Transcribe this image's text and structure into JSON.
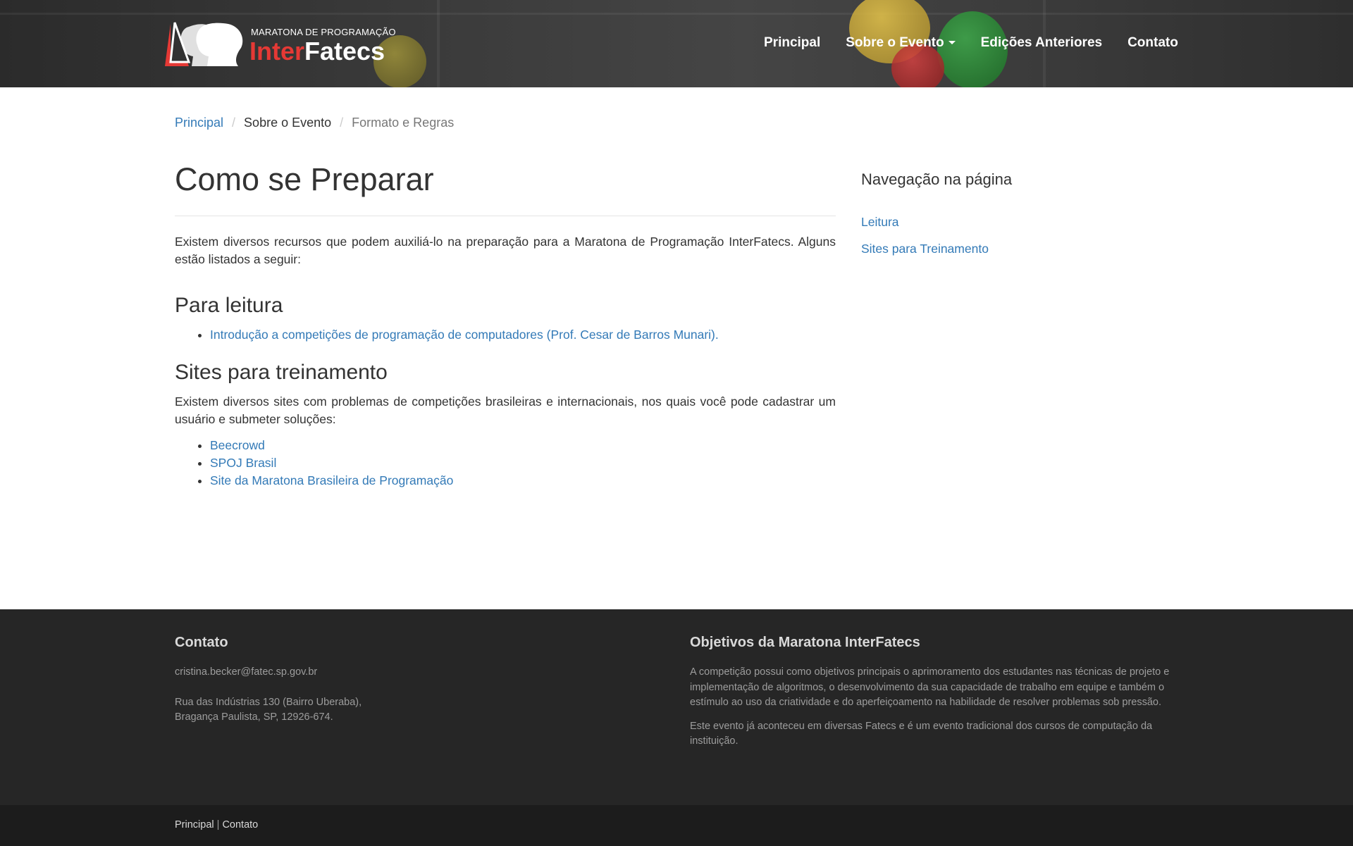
{
  "header": {
    "logo_subtitle": "MARATONA DE PROGRAMAÇÃO",
    "logo_inter": "Inter",
    "logo_fatecs": "Fatecs",
    "nav": {
      "principal": "Principal",
      "sobre": "Sobre o Evento",
      "edicoes": "Edições Anteriores",
      "contato": "Contato"
    }
  },
  "breadcrumb": {
    "item1": "Principal",
    "item2": "Sobre o Evento",
    "item3": "Formato e Regras",
    "separator": "/"
  },
  "main": {
    "title": "Como se Preparar",
    "intro": "Existem diversos recursos que podem auxiliá-lo na preparação para a Maratona de Programação InterFatecs. Alguns estão listados a seguir:",
    "reading_heading": "Para leitura",
    "reading_links": [
      "Introdução a competições de programação de computadores (Prof. Cesar de Barros Munari)."
    ],
    "training_heading": "Sites para treinamento",
    "training_text": "Existem diversos sites com problemas de competições brasileiras e internacionais, nos quais você pode cadastrar um usuário e submeter soluções:",
    "training_links": [
      "Beecrowd",
      "SPOJ Brasil",
      "Site da Maratona Brasileira de Programação"
    ]
  },
  "sidebar": {
    "title": "Navegação na página",
    "links": [
      "Leitura",
      "Sites para Treinamento"
    ]
  },
  "footer": {
    "contact_heading": "Contato",
    "email": "cristina.becker@fatec.sp.gov.br",
    "address_line1": "Rua das Indústrias 130 (Bairro Uberaba),",
    "address_line2": "Bragança Paulista, SP, 12926-674.",
    "objectives_heading": "Objetivos da Maratona InterFatecs",
    "objectives_p1": "A competição possui como objetivos principais o aprimoramento dos estudantes nas técnicas de projeto e implementação de algoritmos, o desenvolvimento da sua capacidade de trabalho em equipe e também o estímulo ao uso da criatividade e do aperfeiçoamento na habilidade de resolver problemas sob pressão.",
    "objectives_p2": "Este evento já aconteceu em diversas Fatecs e é um evento tradicional dos cursos de computação da instituição.",
    "bottom_link1": "Principal",
    "bottom_separator": "|",
    "bottom_link2": "Contato"
  },
  "colors": {
    "link": "#337ab7",
    "logo_red": "#e53935",
    "footer_bg": "#262626",
    "bottom_bg": "#1c1c1c"
  }
}
